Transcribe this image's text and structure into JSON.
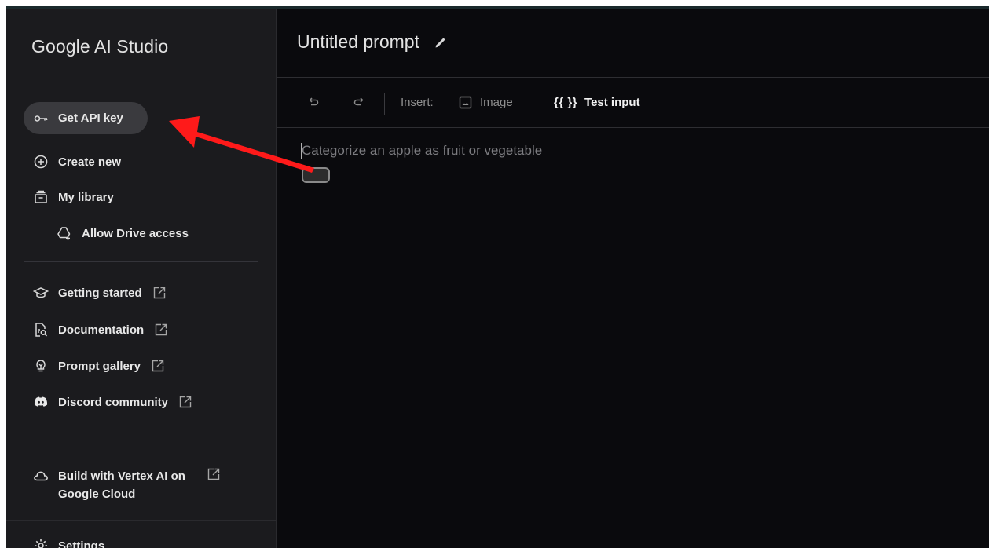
{
  "sidebar": {
    "brand": "Google AI Studio",
    "get_api_key": "Get API key",
    "create_new": "Create new",
    "my_library": "My library",
    "allow_drive": "Allow Drive access",
    "getting_started": "Getting started",
    "documentation": "Documentation",
    "prompt_gallery": "Prompt gallery",
    "discord": "Discord community",
    "vertex_line1": "Build with Vertex AI on",
    "vertex_line2": "Google Cloud",
    "settings": "Settings"
  },
  "main": {
    "title": "Untitled prompt",
    "toolbar": {
      "insert_label": "Insert:",
      "image_label": "Image",
      "test_input_label": "Test input",
      "test_input_glyph": "{{ }}"
    },
    "prompt_placeholder": "Categorize an apple as fruit or vegetable"
  },
  "colors": {
    "annotation_arrow": "#ff1a1a",
    "background": "#0a0a0d",
    "sidebar": "#1b1b1e",
    "pill": "#3a3a3e"
  }
}
